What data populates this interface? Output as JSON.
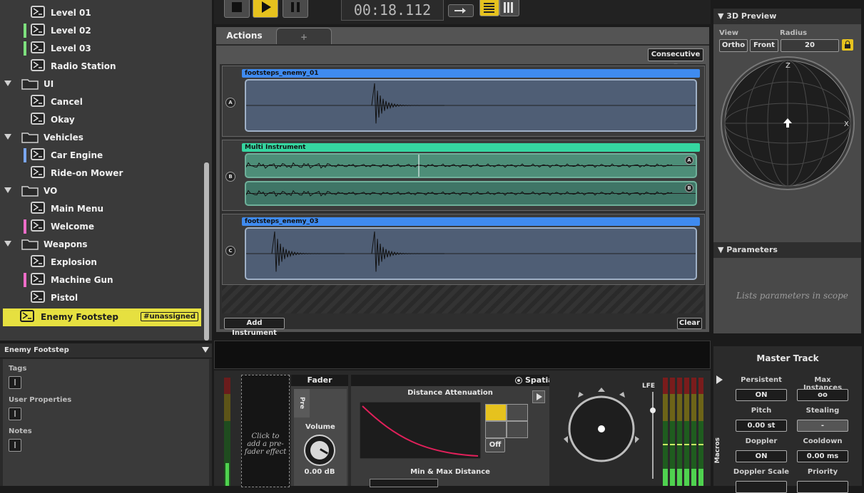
{
  "browser": {
    "rows": [
      {
        "label": "Level 01",
        "kind": "event",
        "indent": 1,
        "color": null
      },
      {
        "label": "Level 02",
        "kind": "event",
        "indent": 1,
        "color": "#7de07d"
      },
      {
        "label": "Level 03",
        "kind": "event",
        "indent": 1,
        "color": "#7de07d"
      },
      {
        "label": "Radio Station",
        "kind": "event",
        "indent": 1,
        "color": null
      },
      {
        "label": "UI",
        "kind": "folder",
        "indent": 0,
        "color": null
      },
      {
        "label": "Cancel",
        "kind": "event",
        "indent": 1,
        "color": null
      },
      {
        "label": "Okay",
        "kind": "event",
        "indent": 1,
        "color": null
      },
      {
        "label": "Vehicles",
        "kind": "folder",
        "indent": 0,
        "color": null
      },
      {
        "label": "Car Engine",
        "kind": "event",
        "indent": 1,
        "color": "#7aa6f0"
      },
      {
        "label": "Ride-on Mower",
        "kind": "event",
        "indent": 1,
        "color": null
      },
      {
        "label": "VO",
        "kind": "folder",
        "indent": 0,
        "color": null
      },
      {
        "label": "Main Menu",
        "kind": "event",
        "indent": 1,
        "color": null
      },
      {
        "label": "Welcome",
        "kind": "event",
        "indent": 1,
        "color": "#ee6cc8"
      },
      {
        "label": "Weapons",
        "kind": "folder",
        "indent": 0,
        "color": null
      },
      {
        "label": "Explosion",
        "kind": "event",
        "indent": 1,
        "color": null
      },
      {
        "label": "Machine Gun",
        "kind": "event",
        "indent": 1,
        "color": "#ee6cc8"
      },
      {
        "label": "Pistol",
        "kind": "event",
        "indent": 1,
        "color": null
      }
    ],
    "selected": {
      "label": "Enemy Footstep",
      "tag": "#unassigned"
    }
  },
  "inspector": {
    "title": "Enemy Footstep",
    "sections": [
      "Tags",
      "User Properties",
      "Notes"
    ]
  },
  "transport": {
    "time": "00:18.112"
  },
  "actions": {
    "tab_active": "Actions",
    "tab_add": "+",
    "mode": "Consecutive",
    "lanes": [
      {
        "label": "A",
        "name": "footsteps_enemy_01",
        "color": "#3f8bf0",
        "sublanes": [
          ""
        ]
      },
      {
        "label": "B",
        "name": "Multi Instrument",
        "color": "#35d6a0",
        "sublanes": [
          "A",
          "B"
        ]
      },
      {
        "label": "C",
        "name": "footsteps_enemy_03",
        "color": "#3f8bf0",
        "sublanes": [
          ""
        ]
      }
    ],
    "add_button": "Add Instrument",
    "clear_button": "Clear"
  },
  "preview3d": {
    "title": "3D Preview",
    "view_label": "View",
    "radius_label": "Radius",
    "ortho": "Ortho",
    "front": "Front",
    "radius": "20",
    "axis_z": "Z",
    "axis_x": "X"
  },
  "parameters": {
    "title": "Parameters",
    "empty": "Lists parameters in scope"
  },
  "deck": {
    "prefader": "Click to add a pre-fader effect",
    "fader_title": "Fader",
    "pre": "Pre",
    "volume_label": "Volume",
    "volume_value": "0.00 dB",
    "spatial_title": "Spatia",
    "distance_title": "Distance Attenuation",
    "off": "Off",
    "minmax": "Min & Max Distance",
    "lfe": "LFE",
    "macros": "Macros"
  },
  "master": {
    "title": "Master Track",
    "props": [
      {
        "label": "Persistent",
        "value": "ON"
      },
      {
        "label": "Max Instances",
        "value": "oo"
      },
      {
        "label": "Pitch",
        "value": "0.00 st"
      },
      {
        "label": "Stealing",
        "value": "-"
      },
      {
        "label": "Doppler",
        "value": "ON"
      },
      {
        "label": "Cooldown",
        "value": "0.00 ms"
      },
      {
        "label": "Doppler Scale",
        "value": ""
      },
      {
        "label": "Priority",
        "value": ""
      }
    ]
  }
}
